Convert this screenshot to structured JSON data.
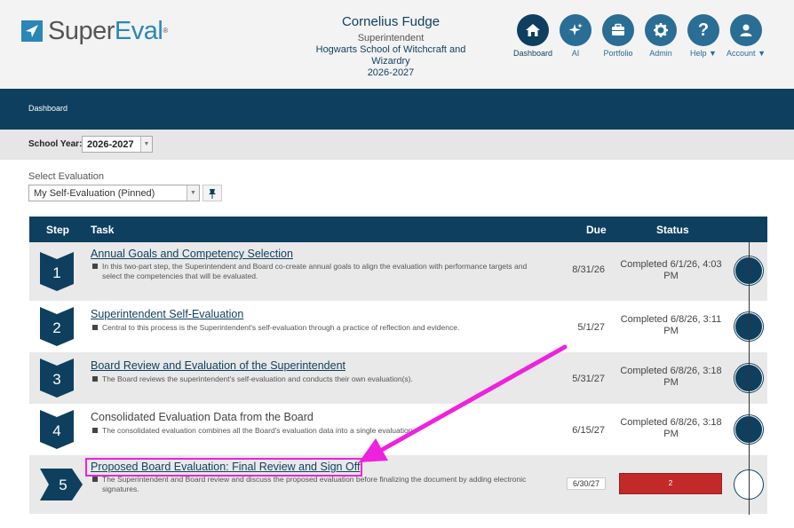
{
  "header": {
    "logo_prefix": "Super",
    "logo_suffix": "Eval",
    "logo_tm": "®",
    "user_name": "Cornelius Fudge",
    "user_role": "Superintendent",
    "school": "Hogwarts School of Witchcraft and Wizardry",
    "year": "2026-2027"
  },
  "nav": {
    "dashboard": "Dashboard",
    "ai": "AI",
    "portfolio": "Portfolio",
    "admin": "Admin",
    "help": "Help",
    "account": "Account"
  },
  "breadcrumb": "Dashboard",
  "school_year": {
    "label": "School Year:",
    "value": "2026-2027"
  },
  "evaluation": {
    "label": "Select Evaluation",
    "value": "My Self-Evaluation (Pinned)"
  },
  "table": {
    "headers": {
      "step": "Step",
      "task": "Task",
      "due": "Due",
      "status": "Status"
    },
    "rows": [
      {
        "step": "1",
        "title": "Annual Goals and Competency Selection",
        "desc": "In this two-part step, the Superintendent and Board co-create annual goals to align the evaluation with performance targets and select the competencies that will be evaluated.",
        "due": "8/31/26",
        "status": "Completed 6/1/26, 4:03 PM"
      },
      {
        "step": "2",
        "title": "Superintendent Self-Evaluation",
        "desc": "Central to this process is the Superintendent's self-evaluation through a practice of reflection and evidence.",
        "due": "5/1/27",
        "status": "Completed 6/8/26, 3:11 PM"
      },
      {
        "step": "3",
        "title": "Board Review and Evaluation of the Superintendent",
        "desc": "The Board reviews the superintendent's self-evaluation and conducts their own evaluation(s).",
        "due": "5/31/27",
        "status": "Completed 6/8/26, 3:18 PM"
      },
      {
        "step": "4",
        "title": "Consolidated Evaluation Data from the Board",
        "desc": "The consolidated evaluation combines all the Board's evaluation data into a single evaluation.",
        "due": "6/15/27",
        "status": "Completed 6/8/26, 3:18 PM"
      },
      {
        "step": "5",
        "title": "Proposed Board Evaluation: Final Review and Sign Off",
        "desc": "The Superintendent and Board review and discuss the proposed evaluation before finalizing the document by adding electronic signatures.",
        "due": "6/30/27",
        "status": "2"
      }
    ]
  },
  "colors": {
    "navy": "#0e3f5e",
    "blue": "#2a6d95",
    "annotation": "#ee22dd",
    "status_red": "#c22a2a"
  }
}
